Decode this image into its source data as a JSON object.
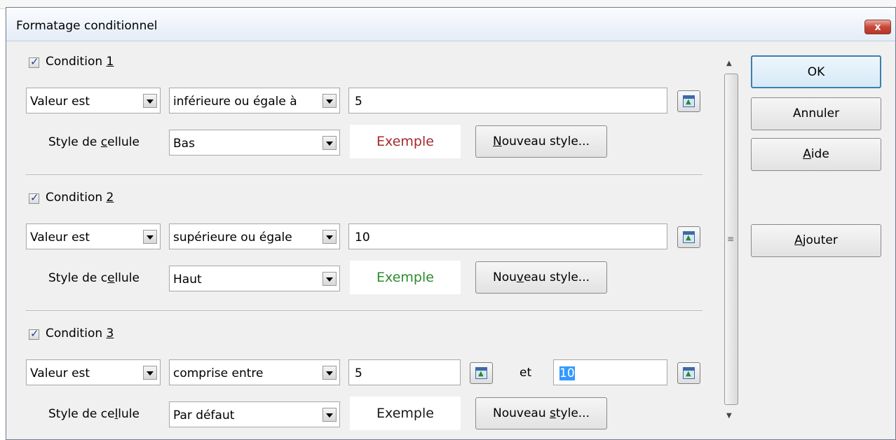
{
  "window": {
    "title": "Formatage conditionnel",
    "close_label": "x"
  },
  "conditions": [
    {
      "label_prefix": "Condition ",
      "label_num": "1",
      "checked": true,
      "type": "Valeur est",
      "operator": "inférieure ou égale à",
      "value1": "5",
      "style_label_a": "Style de ",
      "style_label_ul": "c",
      "style_label_b": "ellule",
      "style": "Bas",
      "example": "Exemple",
      "example_color": "#a52a2a",
      "new_style_a": "",
      "new_style_ul": "N",
      "new_style_b": "ouveau style..."
    },
    {
      "label_prefix": "Condition ",
      "label_num": "2",
      "checked": true,
      "type": "Valeur est",
      "operator": "supérieure ou égale",
      "value1": "10",
      "style_label_a": "Style de c",
      "style_label_ul": "e",
      "style_label_b": "llule",
      "style": "Haut",
      "example": "Exemple",
      "example_color": "#2e8b2e",
      "new_style_a": "Nou",
      "new_style_ul": "v",
      "new_style_b": "eau style..."
    },
    {
      "label_prefix": "Condition ",
      "label_num": "3",
      "checked": true,
      "type": "Valeur est",
      "operator": "comprise entre",
      "value1": "5",
      "connector": "et",
      "value2": "10",
      "style_label_a": "Style de ce",
      "style_label_ul": "l",
      "style_label_b": "lule",
      "style": "Par défaut",
      "example": "Exemple",
      "example_color": "#1a1a1a",
      "new_style_a": "Nouveau ",
      "new_style_ul": "s",
      "new_style_b": "tyle..."
    }
  ],
  "buttons": {
    "ok": "OK",
    "cancel": "Annuler",
    "help_ul": "A",
    "help_rest": "ide",
    "add_ul": "A",
    "add_rest": "jouter"
  },
  "icons": {
    "checkbox": "checkmark-icon",
    "dropdown": "chevron-down-icon",
    "shrink": "shrink-dialog-icon",
    "scroll_up": "arrow-up-icon",
    "scroll_down": "arrow-down-icon",
    "grip": "scroll-grip-icon"
  }
}
